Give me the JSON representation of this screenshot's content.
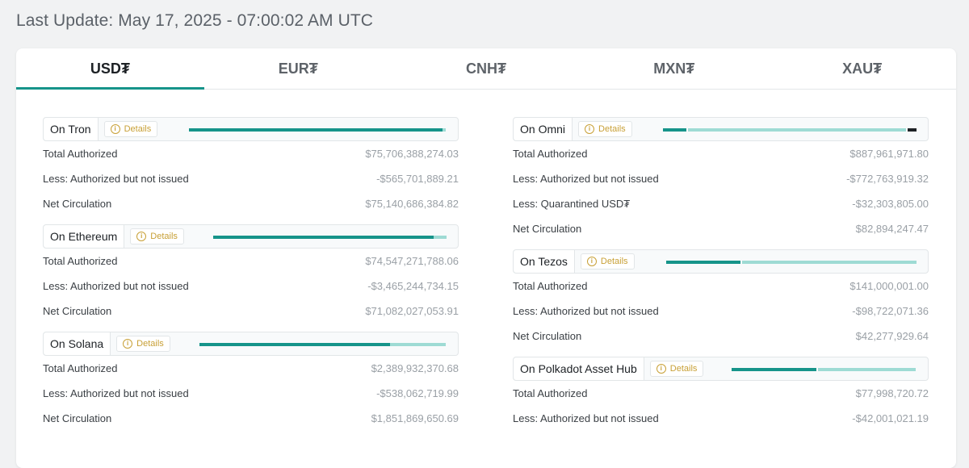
{
  "last_update": "Last Update: May 17, 2025 - 07:00:02 AM UTC",
  "tabs": [
    {
      "label": "USD₮",
      "active": true
    },
    {
      "label": "EUR₮",
      "active": false
    },
    {
      "label": "CNH₮",
      "active": false
    },
    {
      "label": "MXN₮",
      "active": false
    },
    {
      "label": "XAU₮",
      "active": false
    }
  ],
  "details_label": "Details",
  "colors": {
    "accent": "#16948a",
    "accent_light": "#9edbd4",
    "details": "#c8a036"
  },
  "left_chains": [
    {
      "name": "On Tron",
      "rows": [
        {
          "label": "Total Authorized",
          "value": "$75,706,388,274.03"
        },
        {
          "label": "Less: Authorized but not issued",
          "value": "-$565,701,889.21"
        },
        {
          "label": "Net Circulation",
          "value": "$75,140,686,384.82"
        }
      ]
    },
    {
      "name": "On Ethereum",
      "rows": [
        {
          "label": "Total Authorized",
          "value": "$74,547,271,788.06"
        },
        {
          "label": "Less: Authorized but not issued",
          "value": "-$3,465,244,734.15"
        },
        {
          "label": "Net Circulation",
          "value": "$71,082,027,053.91"
        }
      ]
    },
    {
      "name": "On Solana",
      "rows": [
        {
          "label": "Total Authorized",
          "value": "$2,389,932,370.68"
        },
        {
          "label": "Less: Authorized but not issued",
          "value": "-$538,062,719.99"
        },
        {
          "label": "Net Circulation",
          "value": "$1,851,869,650.69"
        }
      ]
    }
  ],
  "right_chains": [
    {
      "name": "On Omni",
      "rows": [
        {
          "label": "Total Authorized",
          "value": "$887,961,971.80"
        },
        {
          "label": "Less: Authorized but not issued",
          "value": "-$772,763,919.32"
        },
        {
          "label": "Less: Quarantined USD₮",
          "value": "-$32,303,805.00"
        },
        {
          "label": "Net Circulation",
          "value": "$82,894,247.47"
        }
      ]
    },
    {
      "name": "On Tezos",
      "rows": [
        {
          "label": "Total Authorized",
          "value": "$141,000,001.00"
        },
        {
          "label": "Less: Authorized but not issued",
          "value": "-$98,722,071.36"
        },
        {
          "label": "Net Circulation",
          "value": "$42,277,929.64"
        }
      ]
    },
    {
      "name": "On Polkadot Asset Hub",
      "rows": [
        {
          "label": "Total Authorized",
          "value": "$77,998,720.72"
        },
        {
          "label": "Less: Authorized but not issued",
          "value": "-$42,001,021.19"
        }
      ]
    }
  ]
}
